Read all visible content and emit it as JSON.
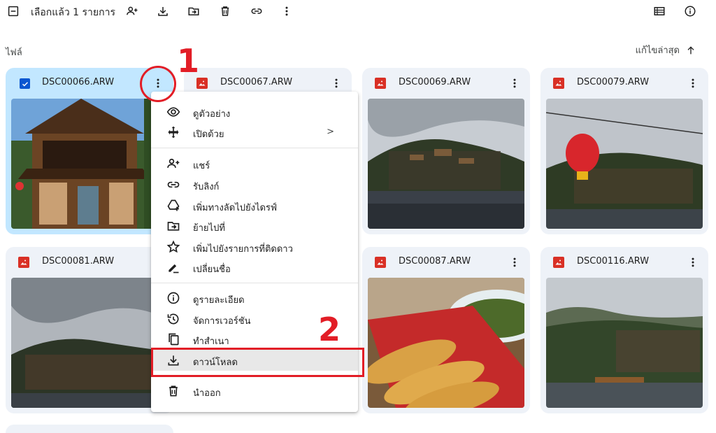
{
  "toolbar": {
    "selection_text": "เลือกแล้ว 1 รายการ",
    "icons": [
      "deselect-icon",
      "share-person-add-icon",
      "download-icon",
      "move-to-folder-icon",
      "trash-icon",
      "link-icon",
      "more-vert-icon",
      "list-view-icon",
      "info-icon"
    ]
  },
  "section": {
    "label": "ไฟล์",
    "sort_label": "แก้ไขล่าสุด",
    "sort_icon": "arrow-up-icon"
  },
  "files": [
    {
      "name": "DSC00066.ARW",
      "selected": true
    },
    {
      "name": "DSC00067.ARW",
      "selected": false
    },
    {
      "name": "DSC00069.ARW",
      "selected": false
    },
    {
      "name": "DSC00079.ARW",
      "selected": false
    },
    {
      "name": "DSC00081.ARW",
      "selected": false
    },
    {
      "name": "DSC00087.ARW",
      "selected": false
    },
    {
      "name": "DSC00116.ARW",
      "selected": false
    }
  ],
  "menu": {
    "items": [
      {
        "label": "ดูตัวอย่าง",
        "icon": "eye-icon"
      },
      {
        "label": "เปิดด้วย",
        "icon": "open-with-icon",
        "arrow": ">"
      },
      {
        "label": "แชร์",
        "icon": "person-add-icon"
      },
      {
        "label": "รับลิงก์",
        "icon": "link-icon"
      },
      {
        "label": "เพิ่มทางลัดไปยังไดรฟ์",
        "icon": "add-to-drive-icon"
      },
      {
        "label": "ย้ายไปที่",
        "icon": "move-icon"
      },
      {
        "label": "เพิ่มไปยังรายการที่ติดดาว",
        "icon": "star-icon"
      },
      {
        "label": "เปลี่ยนชื่อ",
        "icon": "rename-icon"
      },
      {
        "label": "ดูรายละเอียด",
        "icon": "info-icon"
      },
      {
        "label": "จัดการเวอร์ชัน",
        "icon": "history-icon"
      },
      {
        "label": "ทำสำเนา",
        "icon": "copy-icon"
      },
      {
        "label": "ดาวน์โหลด",
        "icon": "download-icon",
        "highlighted": true
      },
      {
        "label": "นำออก",
        "icon": "trash-icon"
      }
    ]
  },
  "annotations": {
    "step1": "1",
    "step2": "2",
    "color": "#e21d26"
  }
}
